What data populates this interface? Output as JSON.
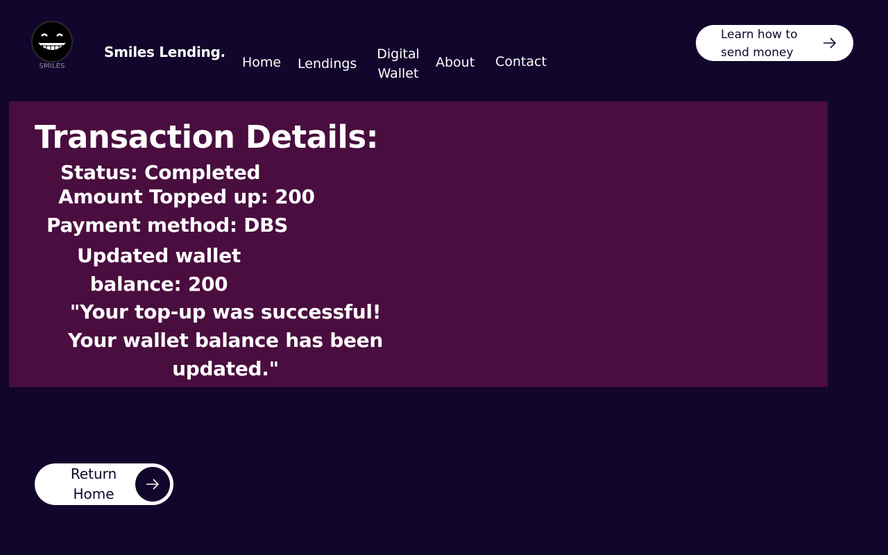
{
  "brand": {
    "logo_text": "SMILES",
    "name": "Smiles Lending."
  },
  "nav": {
    "home": "Home",
    "lendings": "Lendings",
    "wallet": "Digital Wallet",
    "about": "About",
    "contact": "Contact"
  },
  "header": {
    "cta_label": "Learn how to send money",
    "cta_icon": "arrow-right-icon"
  },
  "transaction": {
    "title": "Transaction Details:",
    "status": "Status: Completed",
    "amount": "Amount Topped up: 200",
    "method": "Payment method: DBS",
    "balance": "Updated wallet balance: 200",
    "message": "\"Your top-up was successful! Your wallet balance has been updated.\""
  },
  "footer": {
    "return_label": "Return Home",
    "return_icon": "arrow-right-icon"
  },
  "colors": {
    "background": "#12062c",
    "panel": "#4a0d3f",
    "button": "#ffffff",
    "text": "#ffffff"
  }
}
